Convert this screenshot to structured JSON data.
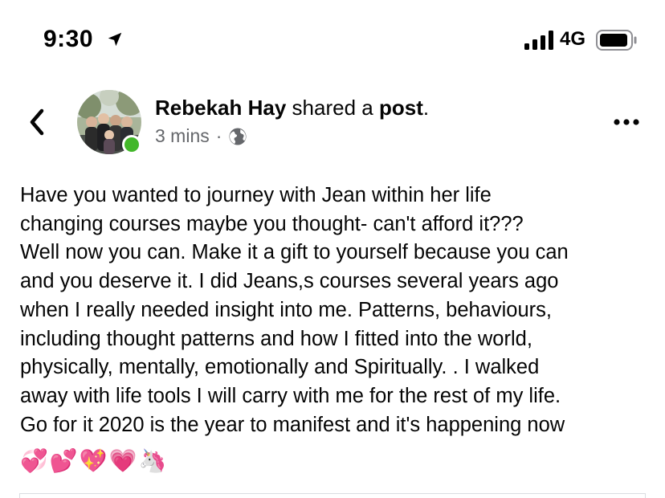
{
  "status_bar": {
    "time": "9:30",
    "network": "4G",
    "location_icon": "location-arrow-icon",
    "signal_icon": "cellular-signal-icon",
    "battery_icon": "battery-icon"
  },
  "post": {
    "author": "Rebekah Hay",
    "action_text": "shared a",
    "object_text": "post",
    "object_suffix": ".",
    "time_ago": "3 mins",
    "separator": "·",
    "privacy_icon": "globe-icon",
    "online": true,
    "text": "Have you wanted to journey with Jean within her life\nchanging courses maybe you  thought- can't afford it???\nWell now you can. Make it a gift to yourself because you can\nand you deserve it.  I did Jeans,s courses several years ago\nwhen I really needed insight into me. Patterns, behaviours,\nincluding thought patterns and how I fitted into the world,\nphysically, mentally, emotionally and Spiritually. . I walked\naway with life tools I will carry with me for the rest of my life.\nGo for it 2020 is the year to manifest and it's happening now",
    "emojis": "💞💕💖💗🦄"
  },
  "nav": {
    "back_icon": "chevron-left-icon",
    "more_icon": "more-horizontal-icon"
  },
  "colors": {
    "online": "#42b72a",
    "secondary_text": "#65676b",
    "primary_text": "#050505"
  }
}
